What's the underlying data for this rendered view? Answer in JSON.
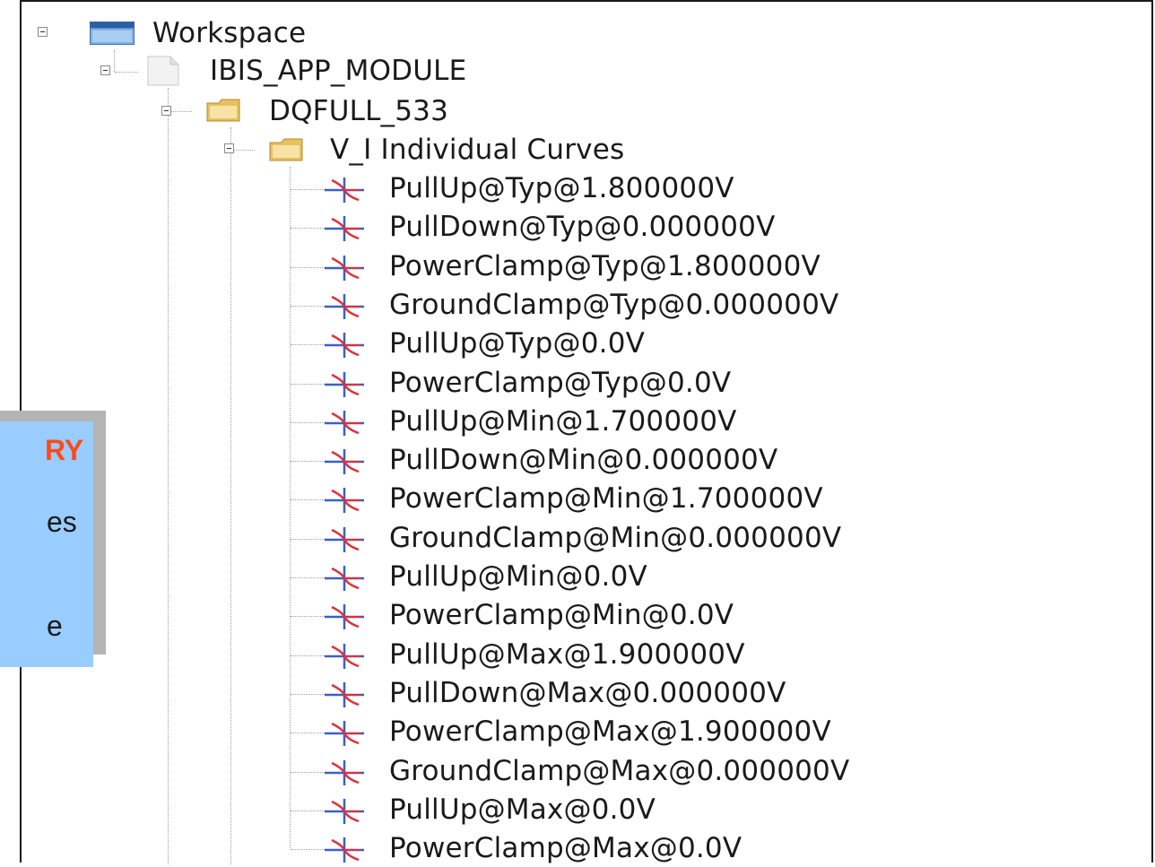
{
  "tree": {
    "root": {
      "label": "Workspace",
      "icon": "window-icon"
    },
    "module": {
      "label": "IBIS_APP_MODULE",
      "icon": "document-icon"
    },
    "component": {
      "label": "DQFULL_533",
      "icon": "folder-icon"
    },
    "group": {
      "label": "V_I Individual Curves",
      "icon": "folder-icon"
    },
    "curves": [
      "PullUp@Typ@1.800000V",
      "PullDown@Typ@0.000000V",
      "PowerClamp@Typ@1.800000V",
      "GroundClamp@Typ@0.000000V",
      "PullUp@Typ@0.0V",
      "PowerClamp@Typ@0.0V",
      "PullUp@Min@1.700000V",
      "PullDown@Min@0.000000V",
      "PowerClamp@Min@1.700000V",
      "GroundClamp@Min@0.000000V",
      "PullUp@Min@0.0V",
      "PowerClamp@Min@0.0V",
      "PullUp@Max@1.900000V",
      "PullDown@Max@0.000000V",
      "PowerClamp@Max@1.900000V",
      "GroundClamp@Max@0.000000V",
      "PullUp@Max@0.0V",
      "PowerClamp@Max@0.0V"
    ],
    "curve_icon": "vi-curve-icon"
  },
  "overlay": {
    "line1": "RY",
    "line2": "es",
    "line3": "e",
    "highlight_color": "#ff4a1a",
    "box_color": "#99ccff"
  }
}
